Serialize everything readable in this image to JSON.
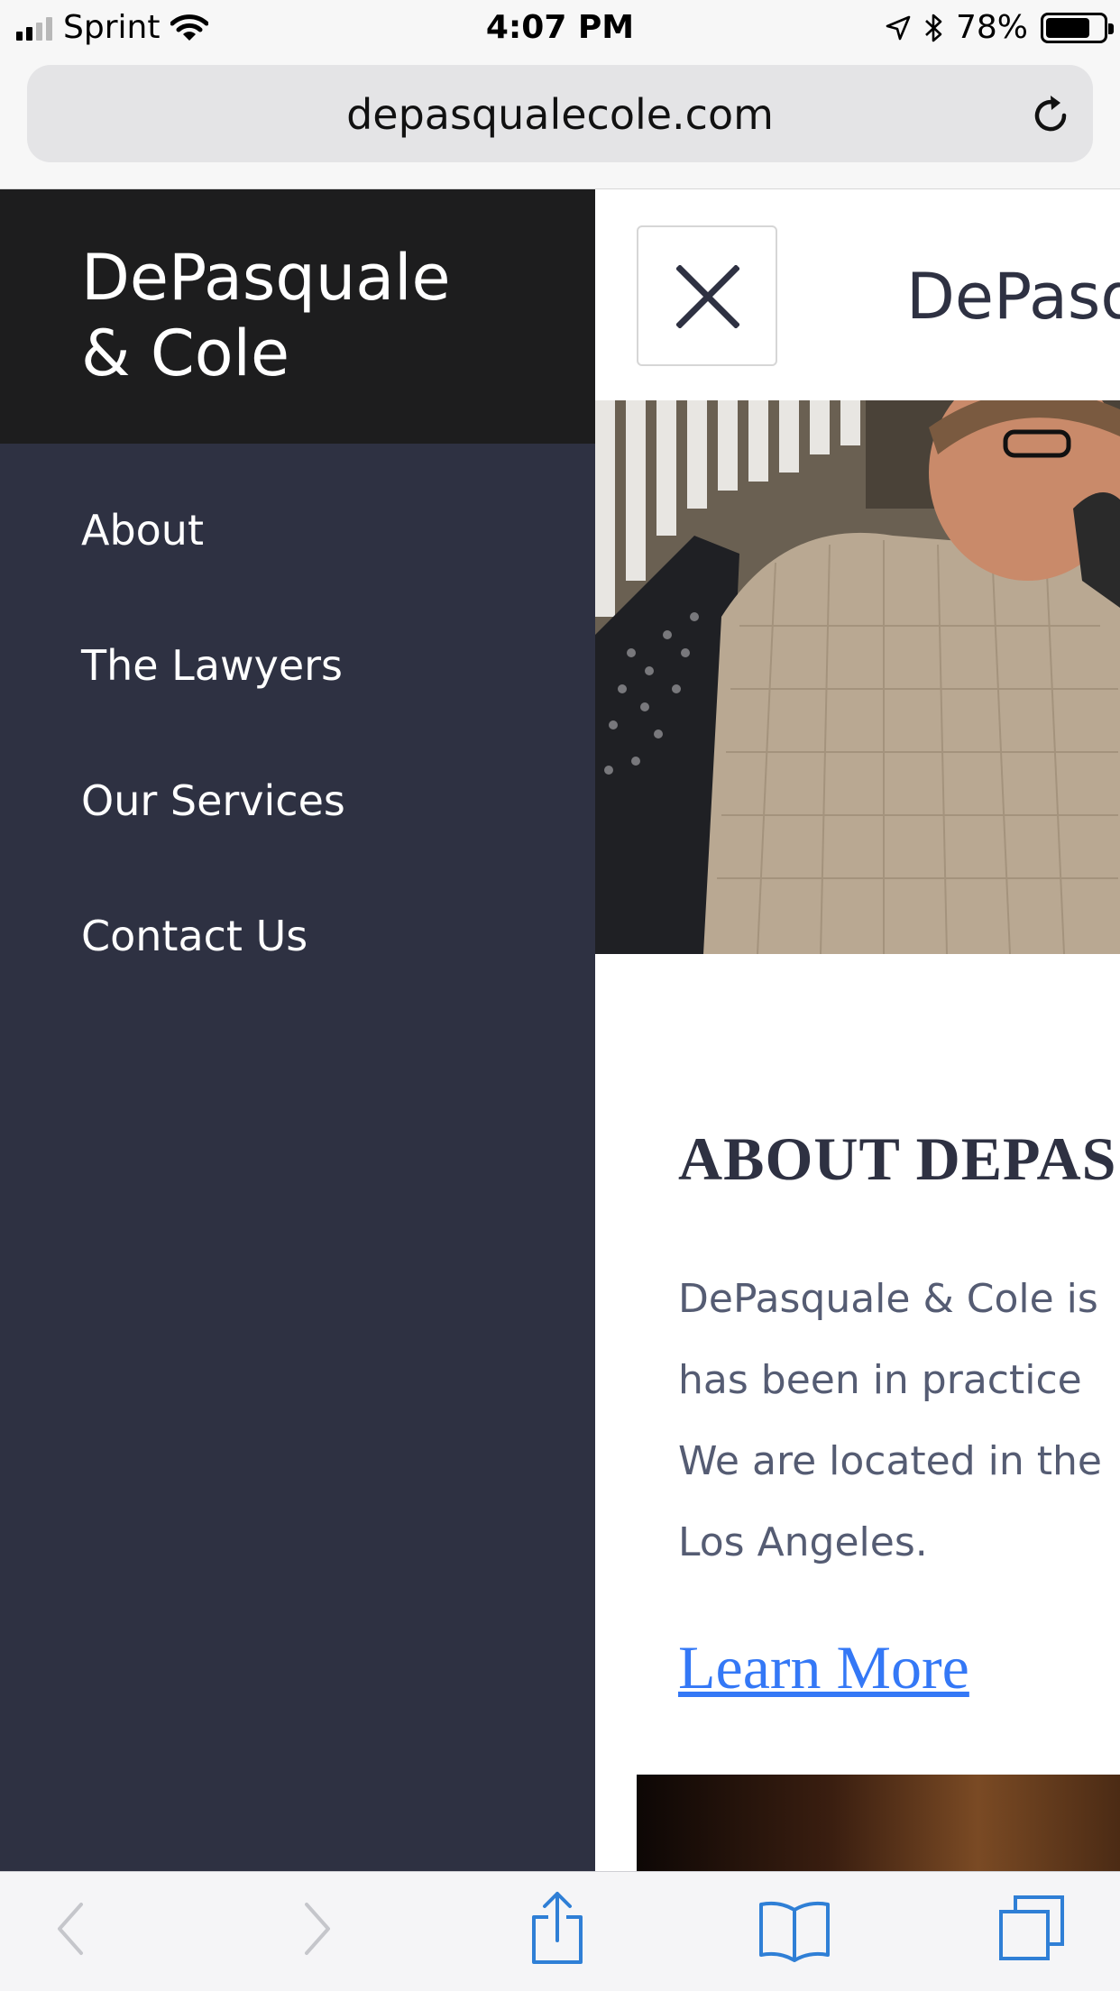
{
  "status_bar": {
    "carrier": "Sprint",
    "time": "4:07 PM",
    "battery": "78%",
    "battery_level": 0.78,
    "icons": [
      "signal-icon",
      "wifi-icon",
      "location-icon",
      "bluetooth-icon",
      "battery-icon"
    ]
  },
  "browser": {
    "url": "depasqualecole.com",
    "reload_icon": "reload-icon"
  },
  "drawer": {
    "brand_line1": "DePasquale",
    "brand_line2": "& Cole",
    "nav": [
      "About",
      "The Lawyers",
      "Our Services",
      "Contact Us"
    ]
  },
  "page": {
    "site_title": "DePasq",
    "close_icon": "close-icon",
    "about_heading": "ABOUT DEPAS",
    "about_lines": [
      "DePasquale & Cole is",
      "has been in practice",
      "We are located in the",
      "Los Angeles."
    ],
    "learn_more": "Learn More"
  },
  "toolbar": {
    "icons": [
      "back-arrow-icon",
      "forward-arrow-icon",
      "share-icon",
      "bookmarks-icon",
      "tabs-icon"
    ]
  },
  "colors": {
    "drawer_bg": "#2e3142",
    "drawer_header_bg": "#1d1d1e",
    "heading": "#2e3142",
    "body_text": "#555c73",
    "link": "#3478f6",
    "ios_blue": "#2f7fd6"
  }
}
